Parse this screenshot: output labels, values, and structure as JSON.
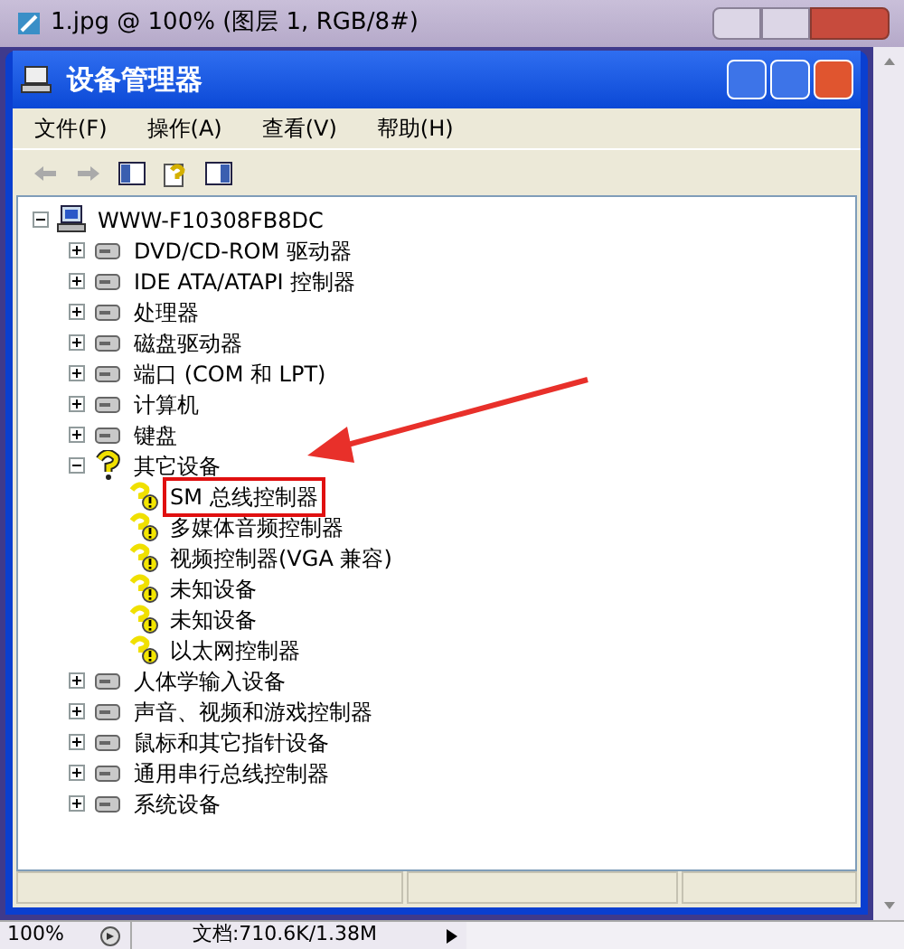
{
  "app_window": {
    "title": "1.jpg @ 100% (图层 1, RGB/8#)"
  },
  "device_manager": {
    "title": "设备管理器",
    "menu": [
      "文件(F)",
      "操作(A)",
      "查看(V)",
      "帮助(H)"
    ],
    "tree": [
      {
        "label": "WWW-F10308FB8DC",
        "kind": "computer",
        "expanded": true,
        "children": [
          {
            "label": "DVD/CD-ROM 驱动器",
            "kind": "category",
            "expanded": false
          },
          {
            "label": "IDE ATA/ATAPI 控制器",
            "kind": "category",
            "expanded": false
          },
          {
            "label": "处理器",
            "kind": "category",
            "expanded": false
          },
          {
            "label": "磁盘驱动器",
            "kind": "category",
            "expanded": false
          },
          {
            "label": "端口 (COM 和 LPT)",
            "kind": "category",
            "expanded": false
          },
          {
            "label": "计算机",
            "kind": "category",
            "expanded": false
          },
          {
            "label": "键盘",
            "kind": "category",
            "expanded": false
          },
          {
            "label": "其它设备",
            "kind": "unknown",
            "expanded": true,
            "children": [
              {
                "label": "SM 总线控制器",
                "kind": "warning",
                "highlighted": true
              },
              {
                "label": "多媒体音频控制器",
                "kind": "warning",
                "highlighted": false
              },
              {
                "label": "视频控制器(VGA 兼容)",
                "kind": "warning",
                "highlighted": false
              },
              {
                "label": "未知设备",
                "kind": "warning",
                "highlighted": false
              },
              {
                "label": "未知设备",
                "kind": "warning",
                "highlighted": false
              },
              {
                "label": "以太网控制器",
                "kind": "warning",
                "highlighted": false
              }
            ]
          },
          {
            "label": "人体学输入设备",
            "kind": "category",
            "expanded": false
          },
          {
            "label": "声音、视频和游戏控制器",
            "kind": "category",
            "expanded": false
          },
          {
            "label": "鼠标和其它指针设备",
            "kind": "category",
            "expanded": false
          },
          {
            "label": "通用串行总线控制器",
            "kind": "category",
            "expanded": false
          },
          {
            "label": "系统设备",
            "kind": "category",
            "expanded": false
          }
        ]
      }
    ]
  },
  "callout_arrow": true,
  "status_bar": {
    "zoom": "100%",
    "document": "文档:710.6K/1.38M"
  }
}
